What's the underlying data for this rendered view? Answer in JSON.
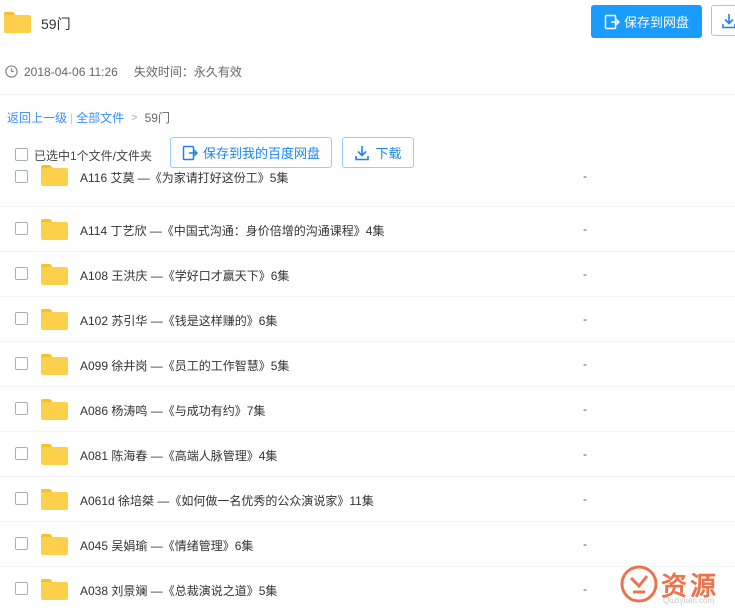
{
  "header": {
    "title": "59门",
    "save_button_label": "保存到网盘"
  },
  "meta": {
    "date": "2018-04-06 11:26",
    "expiry": "失效时间：永久有效"
  },
  "breadcrumb": {
    "back": "返回上一级",
    "all_files": "全部文件",
    "separator_bar": "|",
    "separator_gt": ">",
    "current": "59门"
  },
  "toolbar": {
    "select_label": "已选中1个文件/文件夹",
    "save_baidu_label": "保存到我的百度网盘",
    "download_label": "下载"
  },
  "files": [
    {
      "name": "A116 艾莫 —《为家请打好这份工》5集",
      "size": "-"
    },
    {
      "name": "A114 丁艺欣 —《中国式沟通：身价倍增的沟通课程》4集",
      "size": "-"
    },
    {
      "name": "A108 王洪庆 —《学好口才赢天下》6集",
      "size": "-"
    },
    {
      "name": "A102 苏引华 —《钱是这样赚的》6集",
      "size": "-"
    },
    {
      "name": "A099 徐井岗 —《员工的工作智慧》5集",
      "size": "-"
    },
    {
      "name": "A086 杨涛鸣 —《与成功有约》7集",
      "size": "-"
    },
    {
      "name": "A081 陈海春 —《高端人脉管理》4集",
      "size": "-"
    },
    {
      "name": "A061d 徐培桀 —《如何做一名优秀的公众演说家》11集",
      "size": "-"
    },
    {
      "name": "A045 吴娟瑜 —《情绪管理》6集",
      "size": "-"
    },
    {
      "name": "A038 刘景斓 —《总裁演说之道》5集",
      "size": "-"
    }
  ],
  "watermark": {
    "text": "资源",
    "sub": "Quziyuan.com"
  },
  "colors": {
    "accent": "#1a9bff",
    "link": "#3b8cff",
    "folder": "#fcd04a",
    "watermark": "#e8673a"
  }
}
